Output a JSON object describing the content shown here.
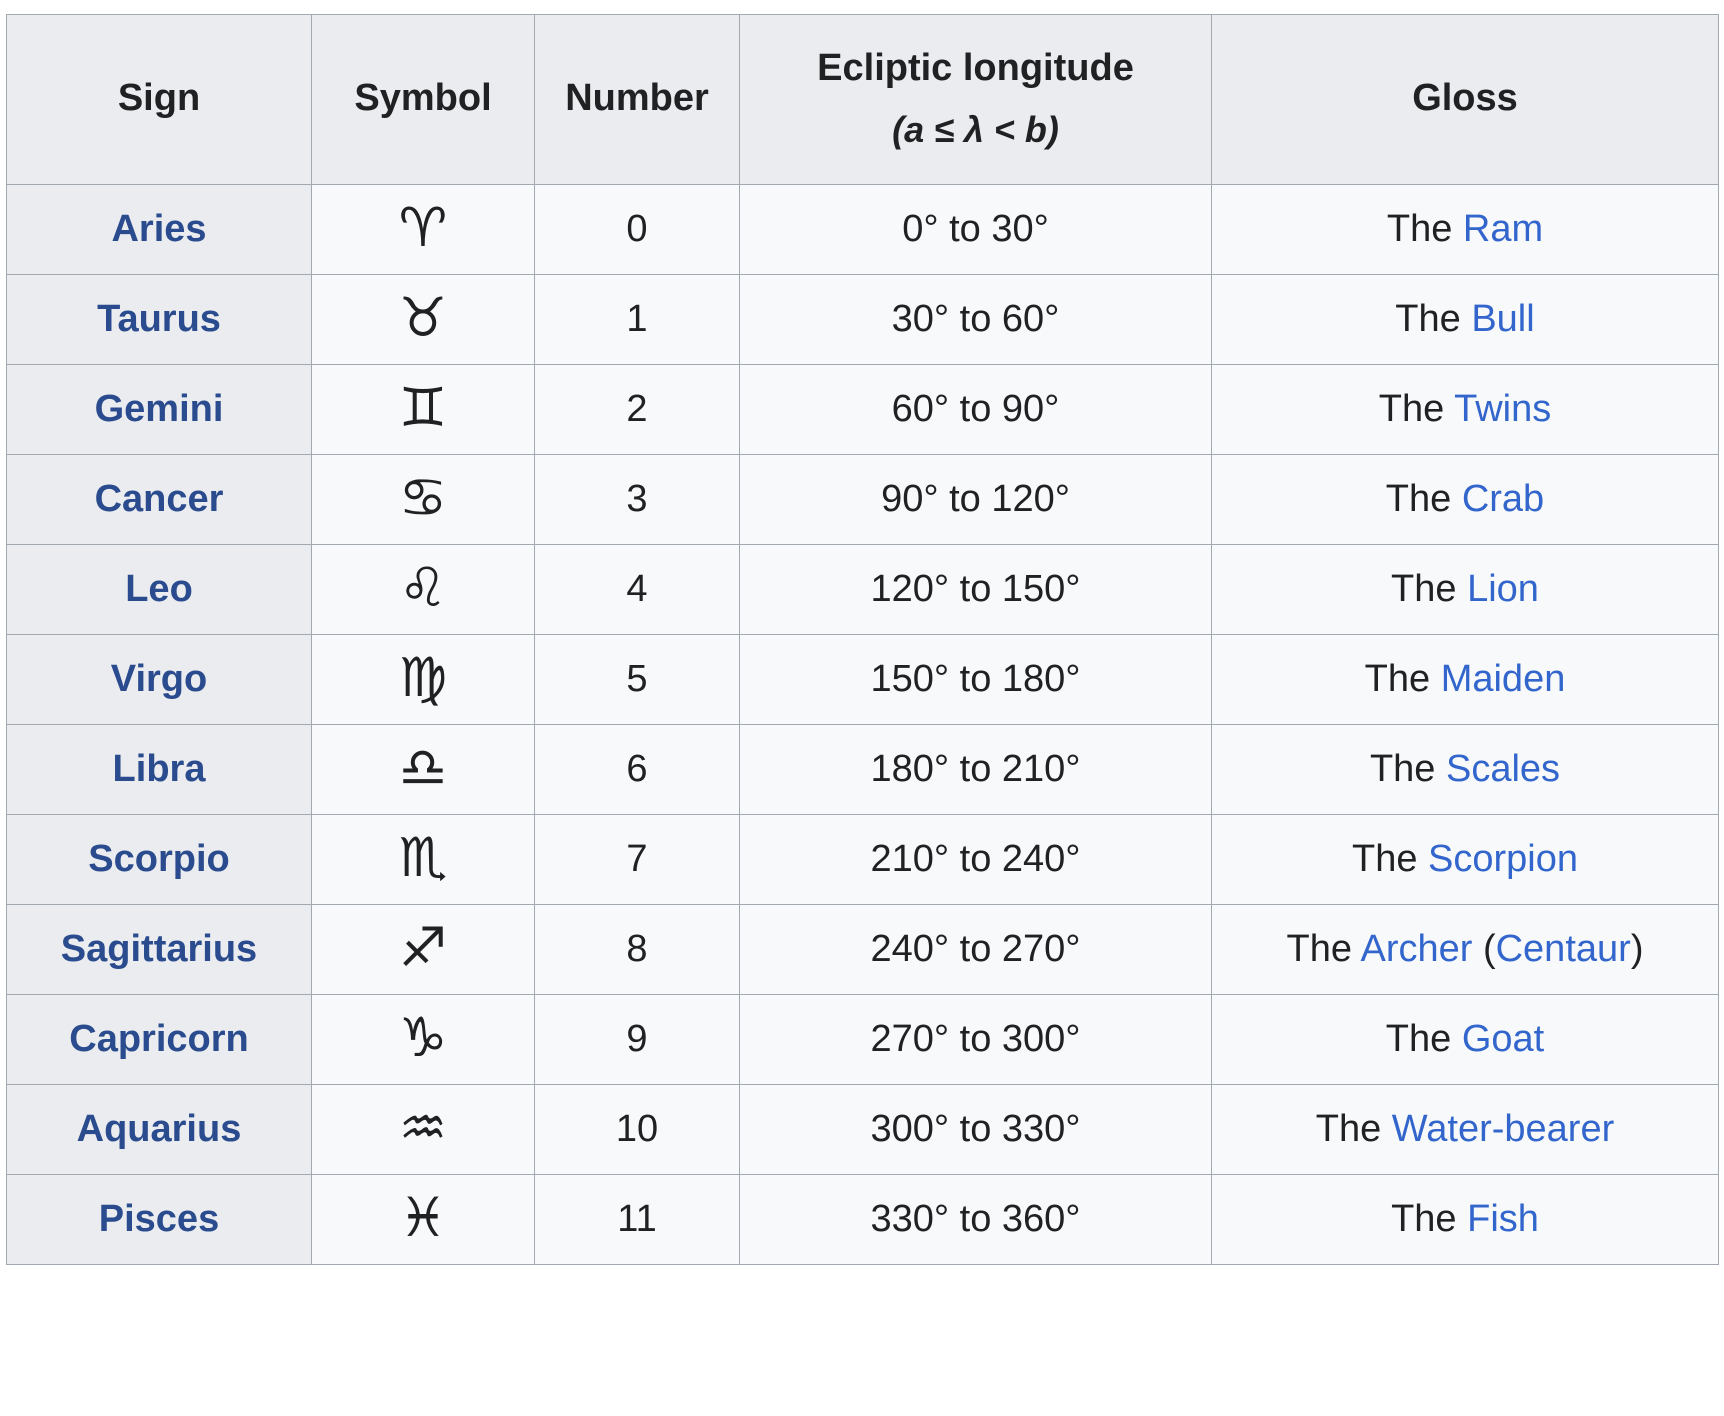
{
  "table": {
    "columns": [
      {
        "key": "sign",
        "label": "Sign"
      },
      {
        "key": "symbol",
        "label": "Symbol"
      },
      {
        "key": "number",
        "label": "Number"
      },
      {
        "key": "longitude",
        "label": "Ecliptic longitude",
        "sublabel": "(a ≤ λ < b)"
      },
      {
        "key": "gloss",
        "label": "Gloss"
      }
    ],
    "colors": {
      "link": "#3366cc",
      "link_sign": "#2a4b8d",
      "header_bg": "#eaecf0",
      "sign_cell_bg": "#eaecf0",
      "cell_bg": "#f8f9fa",
      "border": "#a2a9b1",
      "text": "#202122"
    },
    "rows": [
      {
        "sign": "Aries",
        "symbol": "♈",
        "symbol_name": "aries-symbol",
        "number": "0",
        "longitude": "0° to 30°",
        "gloss_parts": [
          {
            "t": "The ",
            "link": false
          },
          {
            "t": "Ram",
            "link": true
          }
        ]
      },
      {
        "sign": "Taurus",
        "symbol": "♉",
        "symbol_name": "taurus-symbol",
        "number": "1",
        "longitude": "30° to 60°",
        "gloss_parts": [
          {
            "t": "The ",
            "link": false
          },
          {
            "t": "Bull",
            "link": true
          }
        ]
      },
      {
        "sign": "Gemini",
        "symbol": "♊",
        "symbol_name": "gemini-symbol",
        "number": "2",
        "longitude": "60° to 90°",
        "gloss_parts": [
          {
            "t": "The ",
            "link": false
          },
          {
            "t": "Twins",
            "link": true
          }
        ]
      },
      {
        "sign": "Cancer",
        "symbol": "♋",
        "symbol_name": "cancer-symbol",
        "number": "3",
        "longitude": "90° to 120°",
        "gloss_parts": [
          {
            "t": "The ",
            "link": false
          },
          {
            "t": "Crab",
            "link": true
          }
        ]
      },
      {
        "sign": "Leo",
        "symbol": "♌",
        "symbol_name": "leo-symbol",
        "number": "4",
        "longitude": "120° to 150°",
        "gloss_parts": [
          {
            "t": "The ",
            "link": false
          },
          {
            "t": "Lion",
            "link": true
          }
        ]
      },
      {
        "sign": "Virgo",
        "symbol": "♍",
        "symbol_name": "virgo-symbol",
        "number": "5",
        "longitude": "150° to 180°",
        "gloss_parts": [
          {
            "t": "The ",
            "link": false
          },
          {
            "t": "Maiden",
            "link": true
          }
        ]
      },
      {
        "sign": "Libra",
        "symbol": "♎",
        "symbol_name": "libra-symbol",
        "number": "6",
        "longitude": "180° to 210°",
        "gloss_parts": [
          {
            "t": "The ",
            "link": false
          },
          {
            "t": "Scales",
            "link": true
          }
        ]
      },
      {
        "sign": "Scorpio",
        "symbol": "♏",
        "symbol_name": "scorpio-symbol",
        "number": "7",
        "longitude": "210° to 240°",
        "gloss_parts": [
          {
            "t": "The ",
            "link": false
          },
          {
            "t": "Scorpion",
            "link": true
          }
        ]
      },
      {
        "sign": "Sagittarius",
        "symbol": "♐",
        "symbol_name": "sagittarius-symbol",
        "number": "8",
        "longitude": "240° to 270°",
        "gloss_parts": [
          {
            "t": "The ",
            "link": false
          },
          {
            "t": "Archer",
            "link": true
          },
          {
            "t": " (",
            "link": false
          },
          {
            "t": "Centaur",
            "link": true
          },
          {
            "t": ")",
            "link": false
          }
        ]
      },
      {
        "sign": "Capricorn",
        "symbol": "♑",
        "symbol_name": "capricorn-symbol",
        "number": "9",
        "longitude": "270° to 300°",
        "gloss_parts": [
          {
            "t": "The ",
            "link": false
          },
          {
            "t": "Goat",
            "link": true
          }
        ]
      },
      {
        "sign": "Aquarius",
        "symbol": "♒",
        "symbol_name": "aquarius-symbol",
        "number": "10",
        "longitude": "300° to 330°",
        "gloss_parts": [
          {
            "t": "The ",
            "link": false
          },
          {
            "t": "Water-bearer",
            "link": true
          }
        ]
      },
      {
        "sign": "Pisces",
        "symbol": "♓",
        "symbol_name": "pisces-symbol",
        "number": "11",
        "longitude": "330° to 360°",
        "gloss_parts": [
          {
            "t": "The ",
            "link": false
          },
          {
            "t": "Fish",
            "link": true
          }
        ]
      }
    ]
  }
}
